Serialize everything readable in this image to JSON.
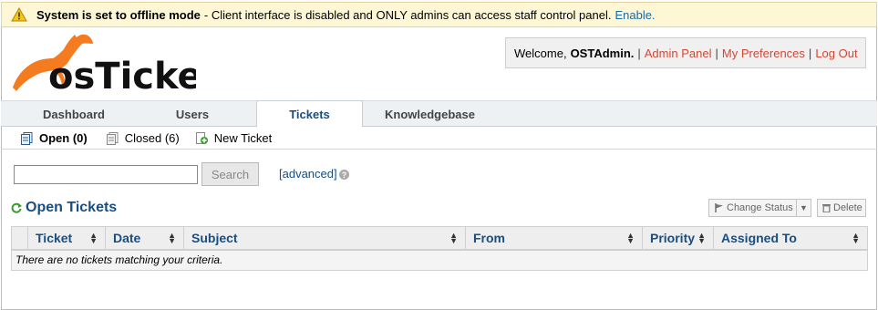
{
  "notice": {
    "bold_text": "System is set to offline mode",
    "text": "- Client interface is disabled and ONLY admins can access staff control panel.",
    "enable_link": "Enable."
  },
  "logo": {
    "text": "osTicket"
  },
  "header": {
    "welcome_prefix": "Welcome,",
    "username": "OSTAdmin.",
    "sep": "|",
    "admin_panel": "Admin Panel",
    "preferences": "My Preferences",
    "logout": "Log Out"
  },
  "nav": {
    "tabs": [
      {
        "label": "Dashboard"
      },
      {
        "label": "Users"
      },
      {
        "label": "Tickets"
      },
      {
        "label": "Knowledgebase"
      }
    ]
  },
  "subnav": {
    "open": "Open (0)",
    "closed": "Closed (6)",
    "new_ticket": "New Ticket"
  },
  "search": {
    "value": "",
    "button": "Search",
    "advanced": "[advanced]",
    "help": "?"
  },
  "section": {
    "title": "Open Tickets",
    "change_status": "Change Status",
    "delete": "Delete"
  },
  "table": {
    "columns": [
      "Ticket",
      "Date",
      "Subject",
      "From",
      "Priority",
      "Assigned To"
    ],
    "empty_message": "There are no tickets matching your criteria."
  },
  "colors": {
    "link_blue": "#184e81",
    "link_red": "#d14836",
    "notice_bg": "#fef7d5",
    "refresh_green": "#3a9a33"
  }
}
